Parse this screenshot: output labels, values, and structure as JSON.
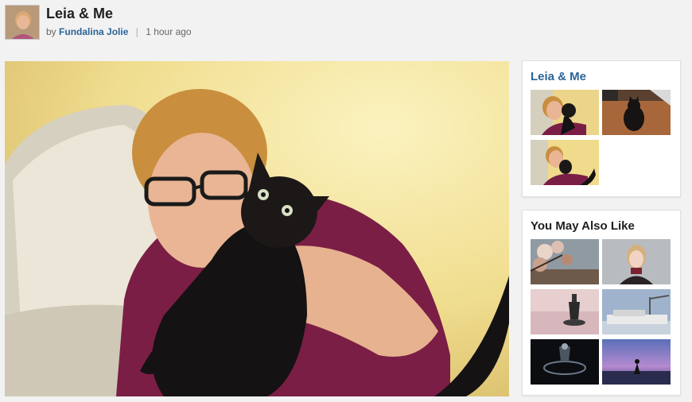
{
  "header": {
    "title": "Leia & Me",
    "by_label": "by",
    "author": "Fundalina Jolie",
    "separator": "|",
    "time": "1 hour ago"
  },
  "album": {
    "title": "Leia & Me",
    "thumbnails": [
      {
        "name": "album-thumb-woman-cat"
      },
      {
        "name": "album-thumb-cat-floor"
      },
      {
        "name": "album-thumb-woman-cat-2"
      }
    ]
  },
  "related": {
    "title": "You May Also Like",
    "thumbnails": [
      {
        "name": "related-thumb-blossom"
      },
      {
        "name": "related-thumb-portrait"
      },
      {
        "name": "related-thumb-beach-figure"
      },
      {
        "name": "related-thumb-boat"
      },
      {
        "name": "related-thumb-dark-water"
      },
      {
        "name": "related-thumb-sunset-silhouette"
      }
    ]
  },
  "colors": {
    "link": "#2a6496",
    "background": "#f2f2f2"
  }
}
